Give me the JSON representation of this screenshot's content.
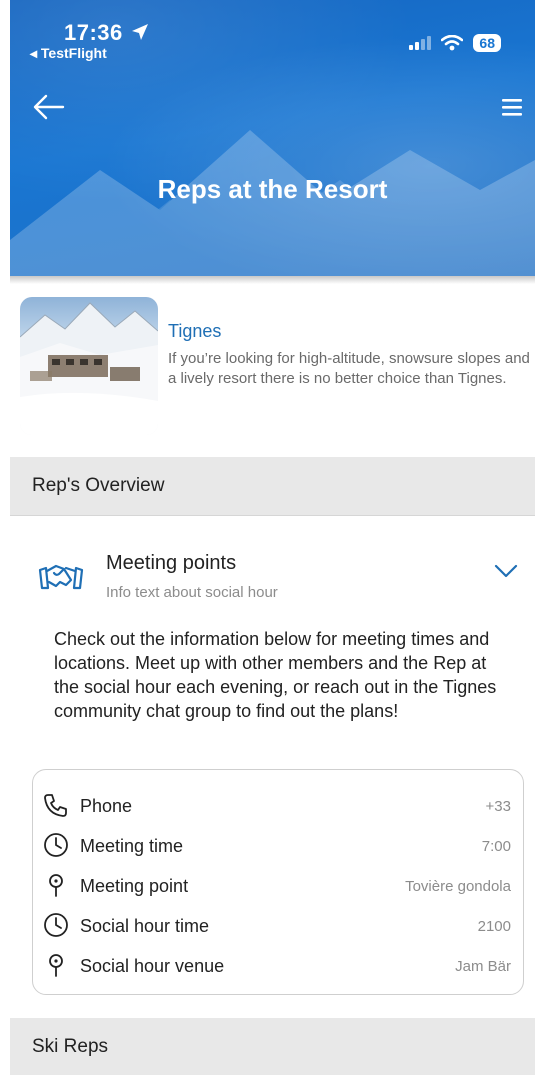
{
  "status_bar": {
    "time": "17:36",
    "back_app": "◂ TestFlight",
    "battery": "68"
  },
  "header": {
    "title": "Reps at the Resort",
    "back_icon": "arrow-left-icon",
    "menu_icon": "hamburger-menu-icon"
  },
  "resort": {
    "name": "Tignes",
    "description": "If you’re looking for high-altitude, snowsure slopes and a lively resort there is no better choice than Tignes."
  },
  "sections": {
    "overview": "Rep's Overview",
    "ski_reps": "Ski Reps"
  },
  "meeting": {
    "title": "Meeting points",
    "subtitle": "Info text about social hour",
    "icon": "handshake-icon",
    "expand_icon": "chevron-down-icon",
    "intro": "Check out the information below for meeting times and locations. Meet up with other members and the Rep at the social hour each evening, or reach out in the Tignes community chat group to find out the plans!",
    "rows": [
      {
        "icon": "phone-icon",
        "label": "Phone",
        "value": "+33"
      },
      {
        "icon": "clock-icon",
        "label": "Meeting time",
        "value": "7:00"
      },
      {
        "icon": "map-pin-icon",
        "label": "Meeting point",
        "value": "Tovière gondola"
      },
      {
        "icon": "clock-icon",
        "label": "Social hour time",
        "value": "2100"
      },
      {
        "icon": "map-pin-icon",
        "label": "Social hour venue",
        "value": "Jam Bär"
      }
    ]
  },
  "colors": {
    "header_blue": "#1976d2",
    "link_blue": "#1f6fb5",
    "section_bg": "#e8e8e8"
  }
}
